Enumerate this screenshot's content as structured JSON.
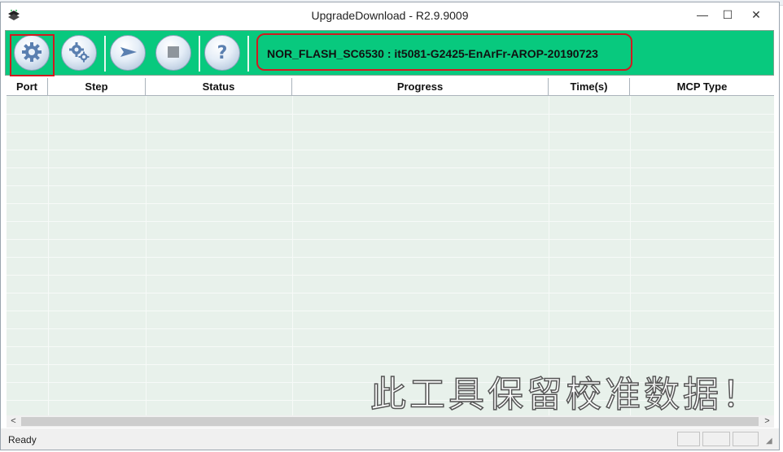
{
  "window": {
    "title": "UpgradeDownload - R2.9.9009",
    "minimize": "—",
    "maximize": "☐",
    "close": "✕"
  },
  "toolbar": {
    "buttons": [
      {
        "name": "load-packet-button",
        "icon": "gear-icon"
      },
      {
        "name": "settings-button",
        "icon": "gears-icon"
      },
      {
        "name": "start-button",
        "icon": "play-arrow-icon"
      },
      {
        "name": "stop-button",
        "icon": "stop-square-icon"
      },
      {
        "name": "help-button",
        "icon": "question-icon"
      }
    ],
    "firmware_label": "NOR_FLASH_SC6530 : it5081-G2425-EnArFr-AROP-20190723"
  },
  "grid": {
    "columns": [
      "Port",
      "Step",
      "Status",
      "Progress",
      "Time(s)",
      "MCP Type"
    ]
  },
  "watermark": "此工具保留校准数据！",
  "statusbar": {
    "text": "Ready"
  },
  "colors": {
    "toolbar_bg": "#08c97e",
    "highlight_red": "#d3191f",
    "grid_bg": "#e8f1eb"
  }
}
